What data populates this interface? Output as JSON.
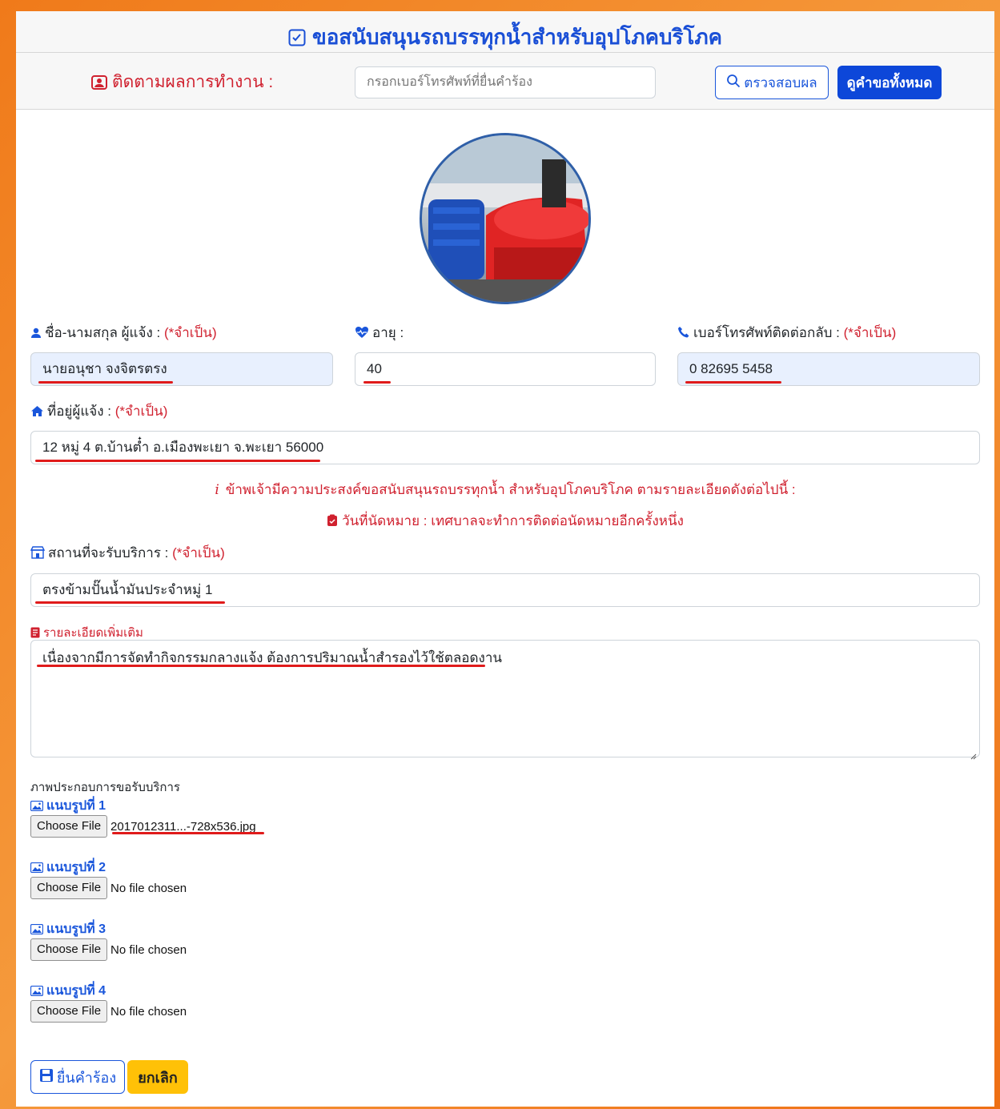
{
  "header": {
    "title": "ขอสนับสนุนรถบรรทุกน้ำสำหรับอุปโภคบริโภค",
    "track_label": "ติดตามผลการทำงาน :",
    "phone_placeholder": "กรอกเบอร์โทรศัพท์ที่ยื่นคำร้อง",
    "check_button": "ตรวจสอบผล",
    "view_all_button": "ดูคำขอทั้งหมด"
  },
  "form": {
    "name": {
      "label": "ชื่อ-นามสกุล ผู้แจ้ง :",
      "required": "(*จำเป็น)",
      "value": "นายอนุชา จงจิตรตรง"
    },
    "age": {
      "label": "อายุ :",
      "value": "40"
    },
    "phone": {
      "label": "เบอร์โทรศัพท์ติดต่อกลับ :",
      "required": "(*จำเป็น)",
      "value": "0 82695 5458"
    },
    "address": {
      "label": "ที่อยู่ผู้แจ้ง :",
      "required": "(*จำเป็น)",
      "value": "12 หมู่ 4 ต.บ้านต๋ำ อ.เมืองพะเยา จ.พะเยา 56000"
    },
    "notice_intent": "ข้าพเจ้ามีความประสงค์ขอสนับสนุนรถบรรทุกน้ำ สำหรับอุปโภคบริโภค ตามรายละเอียดดังต่อไปนี้ :",
    "notice_appointment": "วันที่นัดหมาย : เทศบาลจะทำการติดต่อนัดหมายอีกครั้งหนึ่ง",
    "location": {
      "label": "สถานที่จะรับบริการ :",
      "required": "(*จำเป็น)",
      "value": "ตรงข้ามปั๊นน้ำมันประจำหมู่ 1"
    },
    "details": {
      "label": "รายละเอียดเพิ่มเติม",
      "value": "เนื่องจากมีการจัดทำกิจกรรมกลางแจ้ง ต้องการปริมาณน้ำสำรองไว้ใช้ตลอดงาน"
    }
  },
  "attachments": {
    "caption": "ภาพประกอบการขอรับบริการ",
    "choose_label": "Choose File",
    "items": [
      {
        "title": "แนบรูปที่ 1",
        "file": "2017012311...-728x536.jpg"
      },
      {
        "title": "แนบรูปที่ 2",
        "file": "No file chosen"
      },
      {
        "title": "แนบรูปที่ 3",
        "file": "No file chosen"
      },
      {
        "title": "แนบรูปที่ 4",
        "file": "No file chosen"
      }
    ]
  },
  "actions": {
    "submit": "ยื่นคำร้อง",
    "cancel": "ยกเลิก"
  },
  "colors": {
    "accent": "#1a56db",
    "required": "#d0212f",
    "background": "#f07a1a",
    "cancel": "#ffc107"
  }
}
